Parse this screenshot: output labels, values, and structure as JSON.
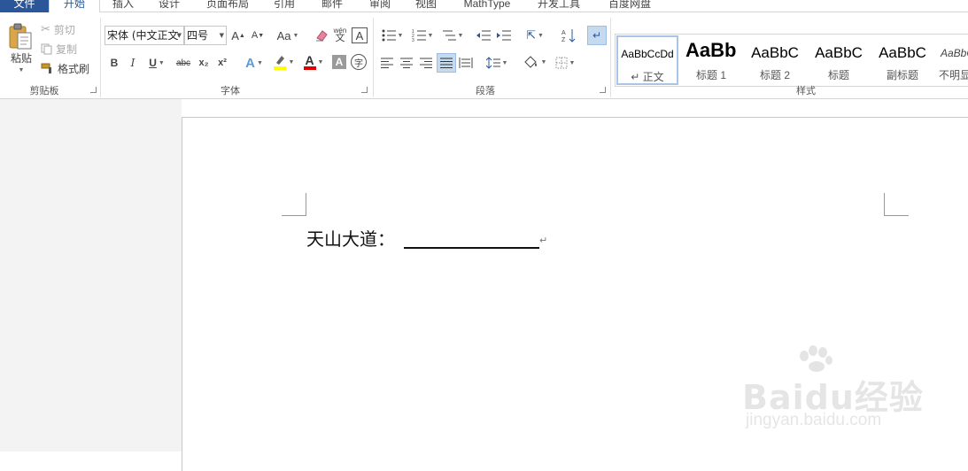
{
  "tabs": {
    "file": "文件",
    "home": "开始",
    "insert": "插入",
    "design": "设计",
    "layout": "页面布局",
    "references": "引用",
    "mailings": "邮件",
    "review": "审阅",
    "view": "视图",
    "mathtype": "MathType",
    "developer": "开发工具",
    "baidu": "百度网盘"
  },
  "clipboard": {
    "paste": "粘贴",
    "cut": "剪切",
    "copy": "复制",
    "format_painter": "格式刷",
    "group_label": "剪贴板"
  },
  "font": {
    "name": "宋体 (中文正文",
    "size": "四号",
    "case_label": "Aa",
    "group_label": "字体",
    "bold": "B",
    "italic": "I",
    "underline": "U",
    "strike": "abc",
    "sub": "x₂",
    "sup": "x²",
    "phonetic_top": "wén",
    "phonetic_bottom": "文"
  },
  "paragraph": {
    "group_label": "段落"
  },
  "styles": {
    "group_label": "样式",
    "items": [
      {
        "preview": "AaBbCcDd",
        "name": "↵ 正文"
      },
      {
        "preview": "AaBb",
        "name": "标题 1"
      },
      {
        "preview": "AaBbC",
        "name": "标题 2"
      },
      {
        "preview": "AaBbC",
        "name": "标题"
      },
      {
        "preview": "AaBbC",
        "name": "副标题"
      },
      {
        "preview": "AaBbC",
        "name": "不明显"
      }
    ]
  },
  "colors": {
    "accent": "#2b579a",
    "highlight": "#ffff00",
    "font_color": "#e00000"
  },
  "document": {
    "text": "天山大道：",
    "para_mark": "↵"
  },
  "watermark": {
    "brand": "Baidu经验",
    "url": "jingyan.baidu.com"
  }
}
